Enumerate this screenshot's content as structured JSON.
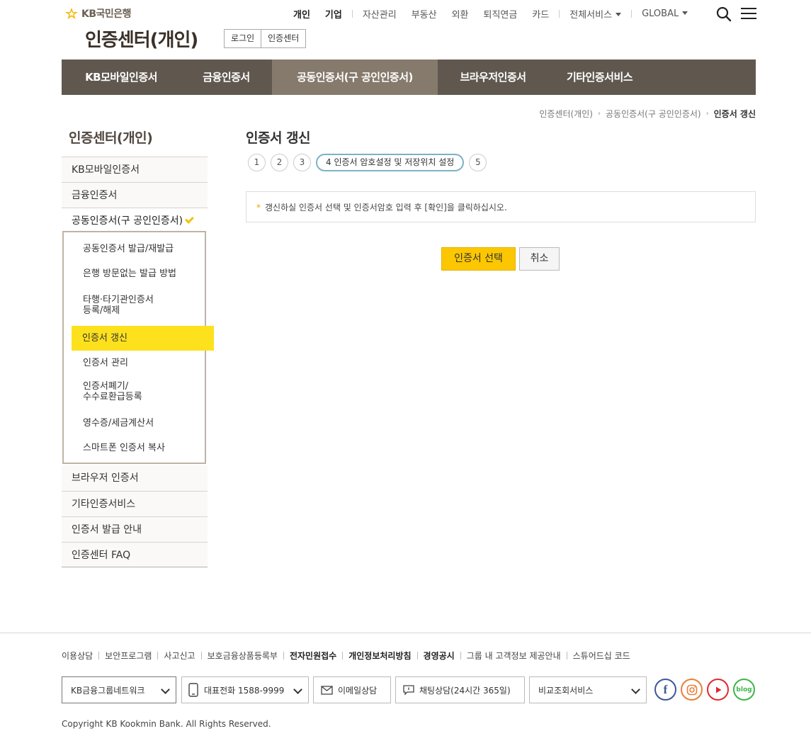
{
  "header": {
    "logo_text": "KB국민은행",
    "top_nav": {
      "personal": "개인",
      "enterprise": "기업",
      "asset": "자산관리",
      "realestate": "부동산",
      "forex": "외환",
      "pension": "퇴직연금",
      "card": "카드",
      "all_services": "전체서비스",
      "global": "GLOBAL"
    },
    "page_title": "인증센터(개인)",
    "login_label": "로그인",
    "cert_center_label": "인증센터"
  },
  "gnb": {
    "items": [
      "KB모바일인증서",
      "금융인증서",
      "공동인증서(구 공인인증서)",
      "브라우저인증서",
      "기타인증서비스"
    ]
  },
  "breadcrumb": [
    "인증센터(개인)",
    "공동인증서(구 공인인증서)",
    "인증서 갱신"
  ],
  "sidebar": {
    "title": "인증센터(개인)",
    "items_before": [
      "KB모바일인증서",
      "금융인증서"
    ],
    "open_item": "공동인증서(구 공인인증서)",
    "sub_items": [
      "공동인증서 발급/재발급",
      "은행 방문없는 발급 방법",
      "타행·타기관인증서",
      "등록/해제",
      "인증서 갱신",
      "인증서 관리",
      "인증서폐기/",
      "수수료환급등록",
      "영수증/세금계산서",
      "스마트폰 인증서 복사"
    ],
    "items_after": [
      "브라우저 인증서",
      "기타인증서비스",
      "인증서 발급 안내",
      "인증센터 FAQ"
    ]
  },
  "content": {
    "title": "인증서 갱신",
    "steps": [
      "1",
      "2",
      "3",
      "4 인증서 암호설정 및 저장위치 설정",
      "5"
    ],
    "notice": "갱신하실 인증서 선택 및 인증서암호 입력 후 [확인]을 클릭하십시오.",
    "notice_bullet": "*",
    "select_button": "인증서 선택",
    "cancel_button": "취소"
  },
  "footer": {
    "links": [
      "이용상담",
      "보안프로그램",
      "사고신고",
      "보호금융상품등록부",
      "전자민원접수",
      "개인정보처리방침",
      "경영공시",
      "그룹 내 고객정보 제공안내",
      "스튜어드십 코드"
    ],
    "group_network": "KB금융그룹네트워크",
    "phone": "대표전화 1588-9999",
    "email": "이메일상담",
    "chat": "채팅상담(24시간 365일)",
    "compare": "비교조회서비스",
    "sns": {
      "blog": "blog"
    },
    "copyright": "Copyright KB Kookmin Bank. All Rights Reserved."
  },
  "colors": {
    "gnb_bg": "#60584f",
    "gnb_active": "#857a6c",
    "accent_yellow": "#fcc700",
    "sub_active": "#fde11d",
    "facebook": "#3b5998",
    "instagram": "#e8803a",
    "youtube": "#e02b2b",
    "blog": "#3eb649"
  }
}
